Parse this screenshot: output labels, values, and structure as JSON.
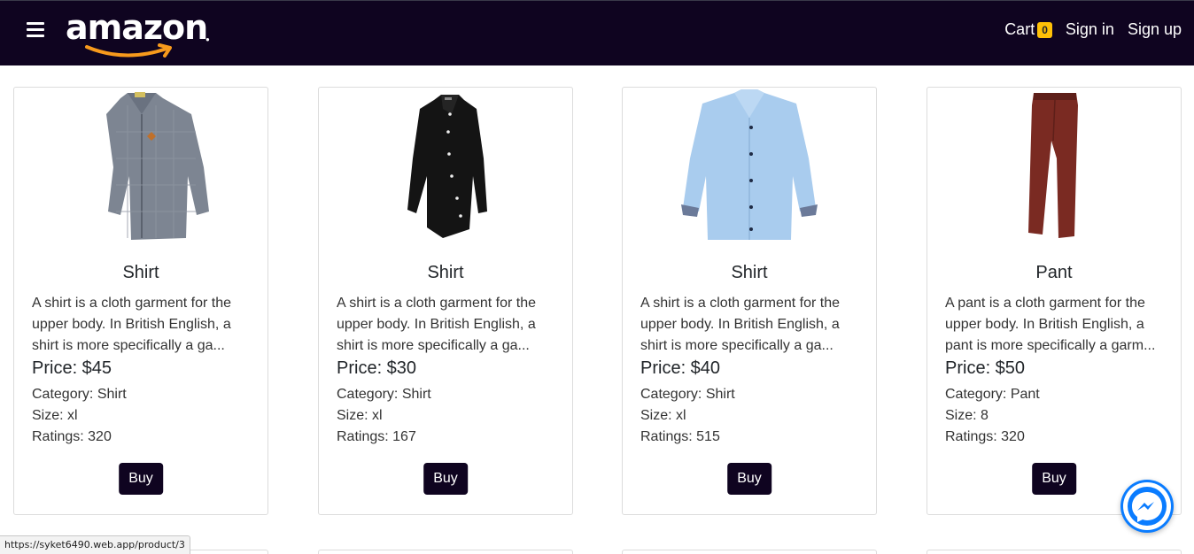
{
  "navbar": {
    "logo_text": "amazon",
    "cart_label": "Cart",
    "cart_count": "0",
    "signin_label": "Sign in",
    "signup_label": "Sign up"
  },
  "colors": {
    "navbar_bg": "#0f0420",
    "badge": "#ffc107",
    "logo_smile": "#f79a1c",
    "messenger": "#0a7cff"
  },
  "products": [
    {
      "title": "Shirt",
      "description": "A shirt is a cloth garment for the upper body. In British English, a shirt is more specifically a ga...",
      "price": "Price: $45",
      "category": "Category: Shirt",
      "size": "Size: xl",
      "ratings": "Ratings: 320",
      "buy_label": "Buy",
      "image_icon": "gray-plaid-shirt"
    },
    {
      "title": "Shirt",
      "description": "A shirt is a cloth garment for the upper body. In British English, a shirt is more specifically a ga...",
      "price": "Price: $30",
      "category": "Category: Shirt",
      "size": "Size: xl",
      "ratings": "Ratings: 167",
      "buy_label": "Buy",
      "image_icon": "black-shirt"
    },
    {
      "title": "Shirt",
      "description": "A shirt is a cloth garment for the upper body. In British English, a shirt is more specifically a ga...",
      "price": "Price: $40",
      "category": "Category: Shirt",
      "size": "Size: xl",
      "ratings": "Ratings: 515",
      "buy_label": "Buy",
      "image_icon": "light-blue-shirt"
    },
    {
      "title": "Pant",
      "description": "A pant is a cloth garment for the upper body. In British English, a pant is more specifically a garm...",
      "price": "Price: $50",
      "category": "Category: Pant",
      "size": "Size: 8",
      "ratings": "Ratings: 320",
      "buy_label": "Buy",
      "image_icon": "maroon-pant"
    }
  ],
  "status_bar": {
    "url": "https://syket6490.web.app/product/3"
  }
}
